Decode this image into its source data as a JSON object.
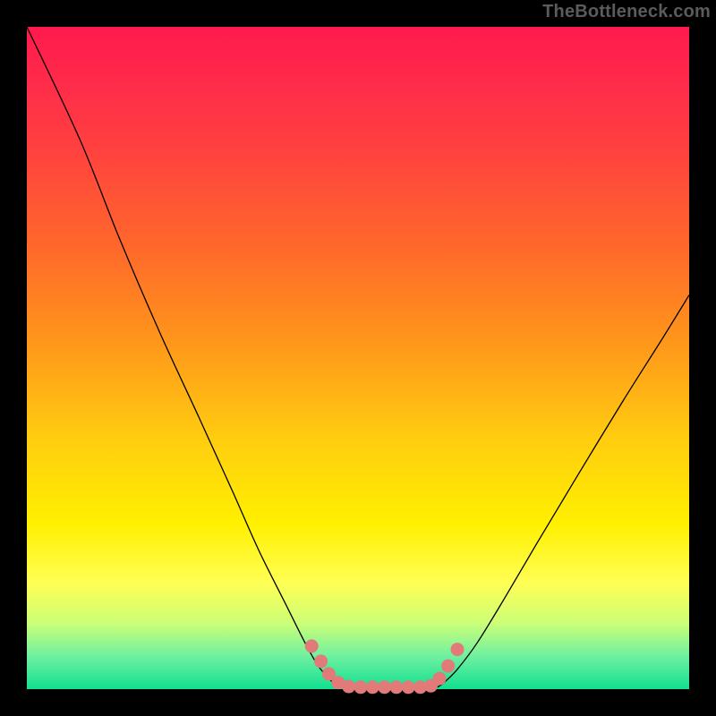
{
  "branding": {
    "text": "TheBottleneck.com"
  },
  "chart_data": {
    "type": "line",
    "title": "",
    "xlabel": "",
    "ylabel": "",
    "xlim": [
      0,
      1
    ],
    "ylim": [
      0,
      100
    ],
    "left_curve": {
      "x": [
        0.0,
        0.08,
        0.14,
        0.2,
        0.26,
        0.31,
        0.35,
        0.39,
        0.42,
        0.44,
        0.46,
        0.47
      ],
      "y": [
        100.0,
        83.0,
        68.0,
        54.0,
        41.0,
        30.0,
        21.0,
        13.0,
        7.0,
        3.5,
        1.2,
        0.3
      ]
    },
    "right_curve": {
      "x": [
        0.62,
        0.63,
        0.65,
        0.68,
        0.72,
        0.77,
        0.83,
        0.9,
        0.96,
        1.0
      ],
      "y": [
        0.3,
        1.0,
        3.0,
        7.0,
        13.5,
        22.0,
        32.0,
        43.5,
        53.0,
        59.5
      ]
    },
    "flat_segment": {
      "x_start": 0.47,
      "x_end": 0.62,
      "y": 0.3
    },
    "markers": {
      "x": [
        0.43,
        0.444,
        0.456,
        0.47,
        0.486,
        0.504,
        0.522,
        0.54,
        0.558,
        0.576,
        0.594,
        0.61,
        0.623,
        0.636,
        0.65
      ],
      "y": [
        6.5,
        4.2,
        2.3,
        1.0,
        0.4,
        0.3,
        0.3,
        0.3,
        0.3,
        0.3,
        0.3,
        0.5,
        1.6,
        3.5,
        6.0
      ],
      "color": "#e17a78",
      "size": 7
    },
    "background_gradient": "rainbow_vertical",
    "frame_color": "#000000"
  }
}
